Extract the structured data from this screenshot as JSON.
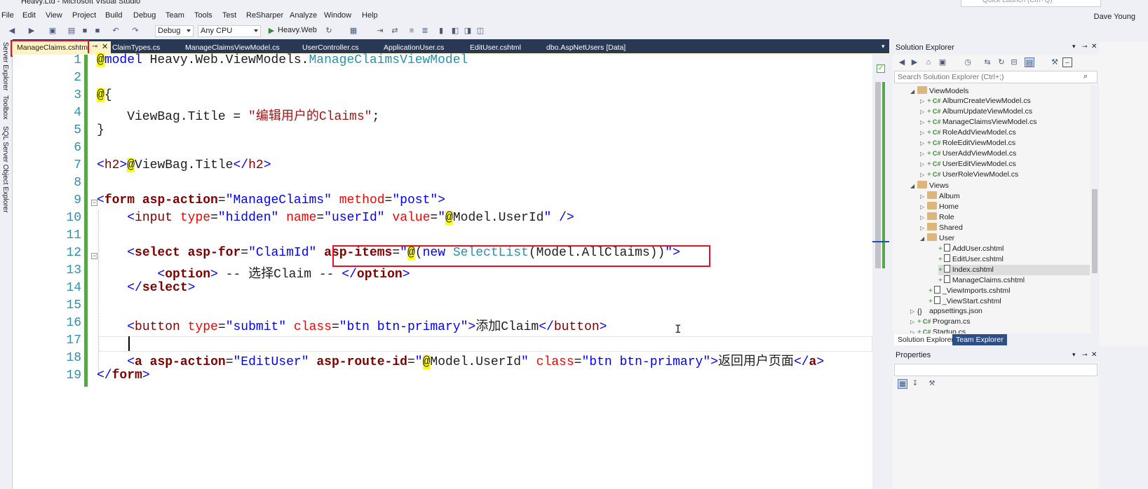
{
  "window": {
    "title": "Heavy.Ltd - Microsoft Visual Studio",
    "quick_launch_placeholder": "Quick Launch (Ctrl+Q)",
    "user": "Dave Young"
  },
  "menu": [
    "File",
    "Edit",
    "View",
    "Project",
    "Build",
    "Debug",
    "Team",
    "Tools",
    "Test",
    "ReSharper",
    "Analyze",
    "Window",
    "Help"
  ],
  "toolbar": {
    "configuration": "Debug",
    "platform": "Any CPU",
    "run_target": "Heavy.Web"
  },
  "left_strip": [
    "Server Explorer",
    "Toolbox",
    "SQL Server Object Explorer"
  ],
  "doc_tabs": [
    "ManageClaims.cshtml",
    "ClaimTypes.cs",
    "ManageClaimsViewModel.cs",
    "UserController.cs",
    "ApplicationUser.cs",
    "EditUser.cshtml",
    "dbo.AspNetUsers [Data]"
  ],
  "editor": {
    "line_numbers": [
      "1",
      "2",
      "3",
      "4",
      "5",
      "6",
      "7",
      "8",
      "9",
      "10",
      "11",
      "12",
      "13",
      "14",
      "15",
      "16",
      "17",
      "18",
      "19"
    ],
    "lines": [
      "@model Heavy.Web.ViewModels.ManageClaimsViewModel",
      "",
      "@{",
      "    ViewBag.Title = \"编辑用户的Claims\";",
      "}",
      "",
      "<h2>@ViewBag.Title</h2>",
      "",
      "<form asp-action=\"ManageClaims\" method=\"post\">",
      "    <input type=\"hidden\" name=\"userId\" value=\"@Model.UserId\" />",
      "",
      "    <select asp-for=\"ClaimId\" asp-items=\"@(new SelectList(Model.AllClaims))\">",
      "        <option> -- 选择Claim -- </option>",
      "    </select>",
      "",
      "    <button type=\"submit\" class=\"btn btn-primary\">添加Claim</button>",
      "",
      "    <a asp-action=\"EditUser\" asp-route-id=\"@Model.UserId\" class=\"btn btn-primary\">返回用户页面</a>",
      "</form>"
    ]
  },
  "solution_explorer": {
    "title": "Solution Explorer",
    "search_placeholder": "Search Solution Explorer (Ctrl+;)",
    "items": [
      {
        "label": "ViewModels",
        "type": "folder",
        "depth": 0,
        "expanded": true
      },
      {
        "label": "AlbumCreateViewModel.cs",
        "type": "cs",
        "depth": 1
      },
      {
        "label": "AlbumUpdateViewModel.cs",
        "type": "cs",
        "depth": 1
      },
      {
        "label": "ManageClaimsViewModel.cs",
        "type": "cs",
        "depth": 1
      },
      {
        "label": "RoleAddViewModel.cs",
        "type": "cs",
        "depth": 1
      },
      {
        "label": "RoleEditViewModel.cs",
        "type": "cs",
        "depth": 1
      },
      {
        "label": "UserAddViewModel.cs",
        "type": "cs",
        "depth": 1
      },
      {
        "label": "UserEditViewModel.cs",
        "type": "cs",
        "depth": 1
      },
      {
        "label": "UserRoleViewModel.cs",
        "type": "cs",
        "depth": 1
      },
      {
        "label": "Views",
        "type": "folder",
        "depth": 0,
        "expanded": true
      },
      {
        "label": "Album",
        "type": "folder",
        "depth": 1
      },
      {
        "label": "Home",
        "type": "folder",
        "depth": 1
      },
      {
        "label": "Role",
        "type": "folder",
        "depth": 1
      },
      {
        "label": "Shared",
        "type": "folder",
        "depth": 1
      },
      {
        "label": "User",
        "type": "folder",
        "depth": 1,
        "expanded": true
      },
      {
        "label": "AddUser.cshtml",
        "type": "file",
        "depth": 2
      },
      {
        "label": "EditUser.cshtml",
        "type": "file",
        "depth": 2
      },
      {
        "label": "Index.cshtml",
        "type": "file",
        "depth": 2,
        "selected": true
      },
      {
        "label": "ManageClaims.cshtml",
        "type": "file",
        "depth": 2
      },
      {
        "label": "_ViewImports.cshtml",
        "type": "file",
        "depth": 1
      },
      {
        "label": "_ViewStart.cshtml",
        "type": "file",
        "depth": 1
      },
      {
        "label": "appsettings.json",
        "type": "json",
        "depth": -1
      },
      {
        "label": "Program.cs",
        "type": "cs",
        "depth": -1
      },
      {
        "label": "Startup.cs",
        "type": "cs",
        "depth": -1
      }
    ],
    "tabs": [
      "Solution Explorer",
      "Team Explorer"
    ]
  },
  "properties": {
    "title": "Properties"
  },
  "colors": {
    "highlight_box": "#e81123",
    "razor_highlight": "#ffff00",
    "tab_bar": "#293955"
  }
}
